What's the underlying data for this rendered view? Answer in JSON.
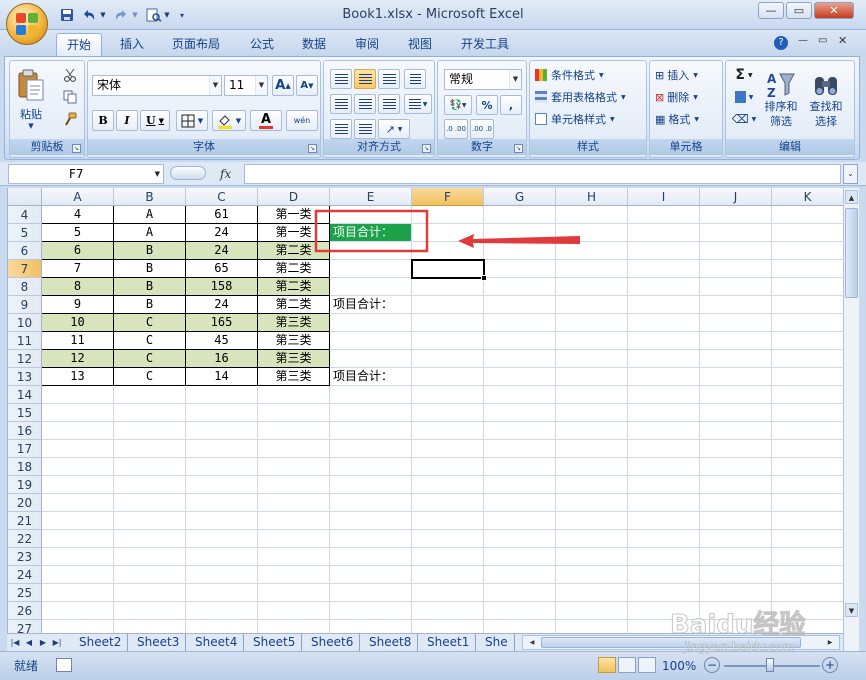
{
  "window": {
    "title": "Book1.xlsx - Microsoft Excel"
  },
  "quick_access": {
    "icons": [
      "save-icon",
      "undo-icon",
      "redo-icon",
      "print-preview-icon",
      "customize-qat-icon"
    ]
  },
  "ribbon": {
    "tabs": [
      {
        "label": "开始",
        "active": true
      },
      {
        "label": "插入"
      },
      {
        "label": "页面布局"
      },
      {
        "label": "公式"
      },
      {
        "label": "数据"
      },
      {
        "label": "审阅"
      },
      {
        "label": "视图"
      },
      {
        "label": "开发工具"
      }
    ],
    "clipboard": {
      "label": "剪贴板",
      "paste": "粘贴"
    },
    "font": {
      "label": "字体",
      "name": "宋体",
      "size": "11",
      "bold": "B",
      "italic": "I",
      "underline": "U",
      "grow": "A",
      "shrink": "A",
      "font_color": "A",
      "phonetic": "wén"
    },
    "alignment": {
      "label": "对齐方式"
    },
    "number": {
      "label": "数字",
      "format": "常规",
      "percent": "%",
      "comma": ",",
      "inc_decimal": ".0 .00",
      "dec_decimal": ".00 .0"
    },
    "styles": {
      "label": "样式",
      "conditional": "条件格式",
      "table": "套用表格格式",
      "cell_styles": "单元格样式"
    },
    "cells": {
      "label": "单元格",
      "insert": "插入",
      "delete": "删除",
      "format": "格式"
    },
    "editing": {
      "label": "编辑",
      "sigma": "Σ",
      "sort_filter_1": "排序和",
      "sort_filter_2": "筛选",
      "find_select_1": "查找和",
      "find_select_2": "选择"
    }
  },
  "formula_bar": {
    "name_box": "F7",
    "fx": "fx",
    "formula": ""
  },
  "sheet": {
    "columns": [
      "A",
      "B",
      "C",
      "D",
      "E",
      "F",
      "G",
      "H",
      "I",
      "J",
      "K"
    ],
    "selected_column": "F",
    "selected_row": "7",
    "rows": [
      {
        "num": "4",
        "a": "4",
        "b": "A",
        "c": "61",
        "d": "第一类",
        "e": ""
      },
      {
        "num": "5",
        "a": "5",
        "b": "A",
        "c": "24",
        "d": "第一类",
        "e": "项目合计："
      },
      {
        "num": "6",
        "a": "6",
        "b": "B",
        "c": "24",
        "d": "第二类",
        "e": ""
      },
      {
        "num": "7",
        "a": "7",
        "b": "B",
        "c": "65",
        "d": "第二类",
        "e": ""
      },
      {
        "num": "8",
        "a": "8",
        "b": "B",
        "c": "158",
        "d": "第二类",
        "e": ""
      },
      {
        "num": "9",
        "a": "9",
        "b": "B",
        "c": "24",
        "d": "第二类",
        "e": "项目合计："
      },
      {
        "num": "10",
        "a": "10",
        "b": "C",
        "c": "165",
        "d": "第三类",
        "e": ""
      },
      {
        "num": "11",
        "a": "11",
        "b": "C",
        "c": "45",
        "d": "第三类",
        "e": ""
      },
      {
        "num": "12",
        "a": "12",
        "b": "C",
        "c": "16",
        "d": "第三类",
        "e": ""
      },
      {
        "num": "13",
        "a": "13",
        "b": "C",
        "c": "14",
        "d": "第三类",
        "e": "项目合计："
      },
      {
        "num": "14"
      },
      {
        "num": "15"
      },
      {
        "num": "16"
      },
      {
        "num": "17"
      },
      {
        "num": "18"
      },
      {
        "num": "19"
      },
      {
        "num": "20"
      },
      {
        "num": "21"
      },
      {
        "num": "22"
      },
      {
        "num": "23"
      },
      {
        "num": "24"
      },
      {
        "num": "25"
      },
      {
        "num": "26"
      },
      {
        "num": "27"
      }
    ],
    "green_rows": [
      "6",
      "8",
      "10",
      "12"
    ]
  },
  "sheet_tabs": [
    "Sheet2",
    "Sheet3",
    "Sheet4",
    "Sheet5",
    "Sheet6",
    "Sheet8",
    "Sheet1",
    "She"
  ],
  "status": {
    "ready": "就绪",
    "zoom": "100%"
  },
  "watermark": {
    "text": "Baidu经验",
    "url": "jingyan.baidu.com"
  },
  "colors": {
    "accent": "#15428b",
    "highlight_cell": "#1ca34a",
    "band_fill": "#d8e4bc",
    "callout": "#e03a3a"
  }
}
